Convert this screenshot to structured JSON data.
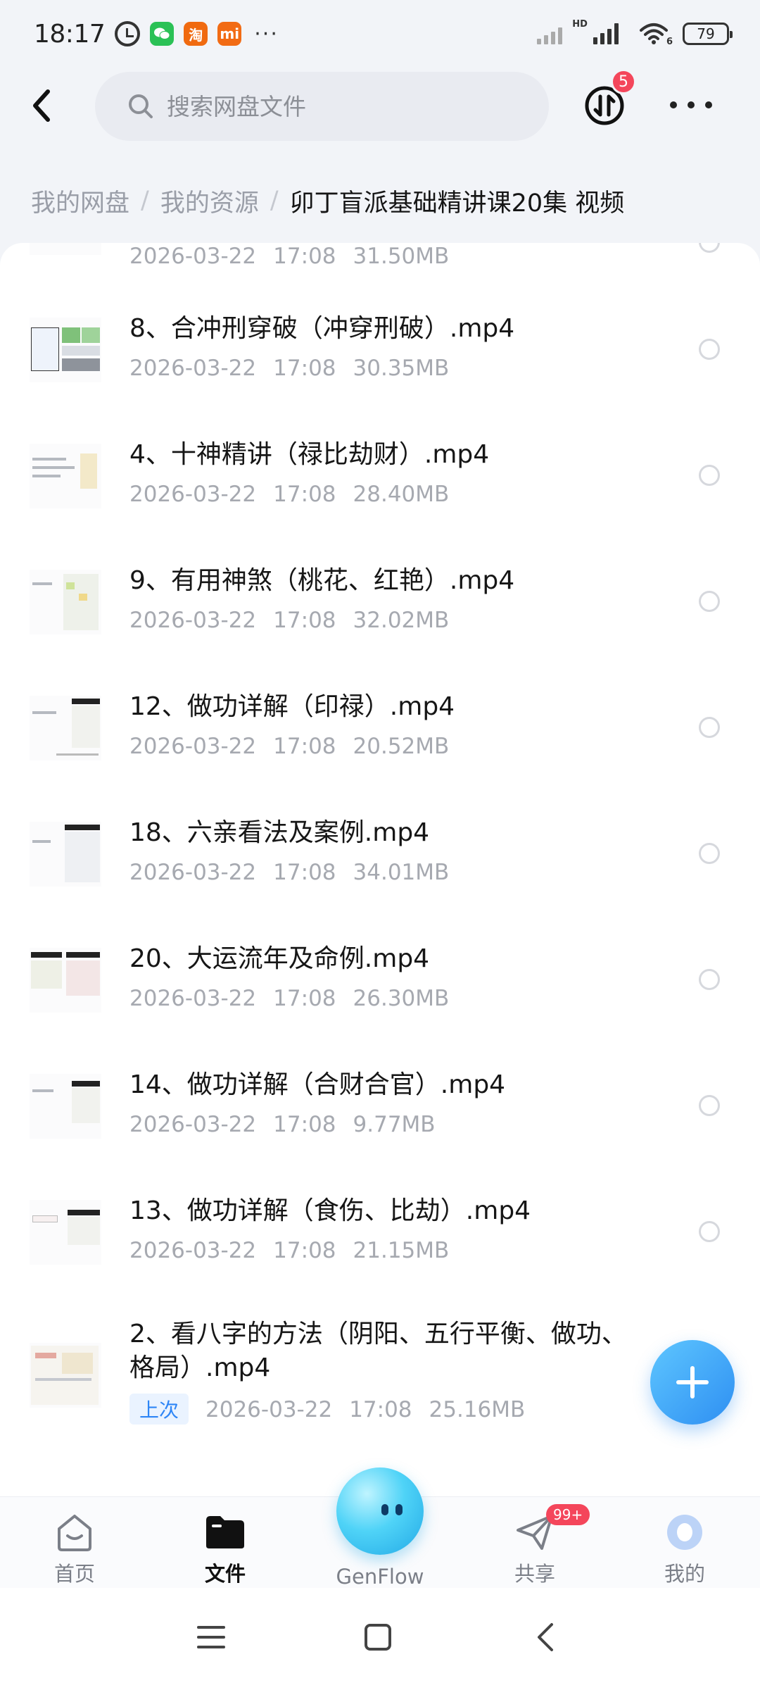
{
  "status_bar": {
    "time": "18:17",
    "app_icons": [
      "alarm-icon",
      "wechat-icon",
      "taobao-icon",
      "mi-icon"
    ],
    "taobao_glyph": "淘",
    "mi_glyph": "mi",
    "more": "···",
    "network_label": "HD",
    "wifi_label": "6",
    "battery": "79"
  },
  "header": {
    "search_placeholder": "搜索网盘文件",
    "transfer_badge": "5"
  },
  "breadcrumb": {
    "root": "我的网盘",
    "parent": "我的资源",
    "current": "卯丁盲派基础精讲课20集 视频"
  },
  "files": [
    {
      "name": "",
      "date": "2026-03-22",
      "time": "17:08",
      "size": "31.50MB"
    },
    {
      "name": "8、合冲刑穿破（冲穿刑破）.mp4",
      "date": "2026-03-22",
      "time": "17:08",
      "size": "30.35MB"
    },
    {
      "name": "4、十神精讲（禄比劫财）.mp4",
      "date": "2026-03-22",
      "time": "17:08",
      "size": "28.40MB"
    },
    {
      "name": "9、有用神煞（桃花、红艳）.mp4",
      "date": "2026-03-22",
      "time": "17:08",
      "size": "32.02MB"
    },
    {
      "name": "12、做功详解（印禄）.mp4",
      "date": "2026-03-22",
      "time": "17:08",
      "size": "20.52MB"
    },
    {
      "name": "18、六亲看法及案例.mp4",
      "date": "2026-03-22",
      "time": "17:08",
      "size": "34.01MB"
    },
    {
      "name": "20、大运流年及命例.mp4",
      "date": "2026-03-22",
      "time": "17:08",
      "size": "26.30MB"
    },
    {
      "name": "14、做功详解（合财合官）.mp4",
      "date": "2026-03-22",
      "time": "17:08",
      "size": "9.77MB"
    },
    {
      "name": "13、做功详解（食伤、比劫）.mp4",
      "date": "2026-03-22",
      "time": "17:08",
      "size": "21.15MB"
    },
    {
      "name_line1": "2、看八字的方法（阴阳、五行平衡、做功、",
      "name_line2": "格局）.mp4",
      "tag": "上次",
      "date": "2026-03-22",
      "time": "17:08",
      "size": "25.16MB"
    }
  ],
  "bottom_nav": {
    "home": "首页",
    "files": "文件",
    "genflow": "GenFlow",
    "share": "共享",
    "share_badge": "99+",
    "me": "我的"
  },
  "colors": {
    "accent": "#2e8ff2",
    "badge": "#f4465b",
    "tag_bg": "#eaf3ff",
    "tag_text": "#2f86f6"
  }
}
